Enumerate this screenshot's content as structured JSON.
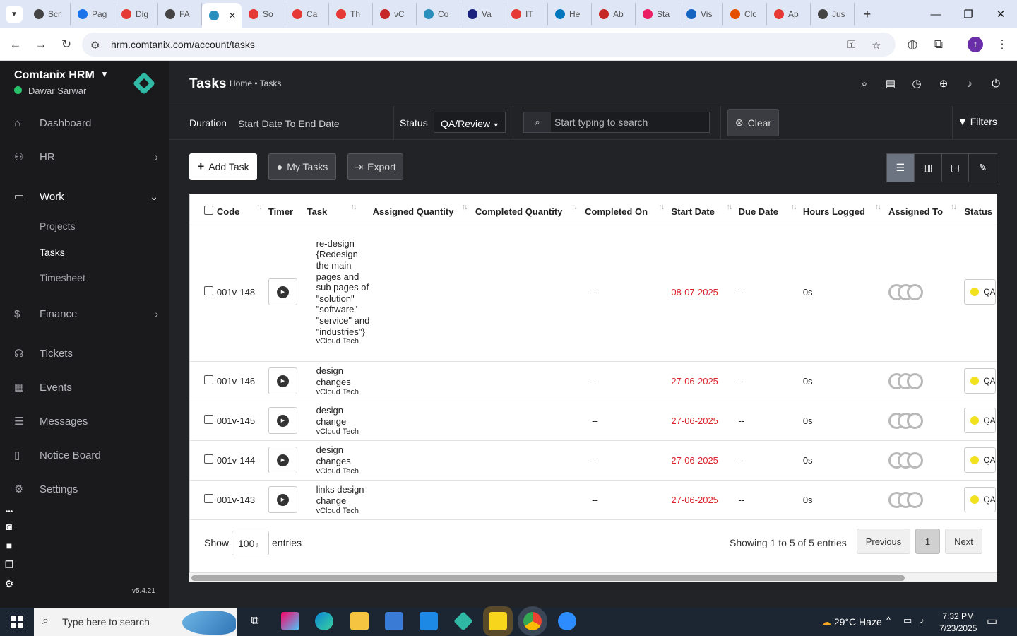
{
  "browser": {
    "tabs": [
      {
        "label": "Scr",
        "color": "#444"
      },
      {
        "label": "Pag",
        "color": "#1a73e8"
      },
      {
        "label": "Dig",
        "color": "#e53935"
      },
      {
        "label": "FA",
        "color": "#444"
      },
      {
        "label": "",
        "color": "#2a8fbd",
        "active": true
      },
      {
        "label": "So",
        "color": "#e53935"
      },
      {
        "label": "Ca",
        "color": "#e53935"
      },
      {
        "label": "Th",
        "color": "#e53935"
      },
      {
        "label": "vC",
        "color": "#c62828"
      },
      {
        "label": "Co",
        "color": "#2a8fbd"
      },
      {
        "label": "Va",
        "color": "#1a237e"
      },
      {
        "label": "IT",
        "color": "#e53935"
      },
      {
        "label": "He",
        "color": "#0277bd"
      },
      {
        "label": "Ab",
        "color": "#c62828"
      },
      {
        "label": "Sta",
        "color": "#e91e63"
      },
      {
        "label": "Vis",
        "color": "#1565c0"
      },
      {
        "label": "Clc",
        "color": "#e65100"
      },
      {
        "label": "Ap",
        "color": "#e53935"
      },
      {
        "label": "Jus",
        "color": "#444"
      }
    ],
    "url": "hrm.comtanix.com/account/tasks",
    "profile_initial": "t"
  },
  "app": {
    "brand": "Comtanix HRM",
    "user": "Dawar Sarwar",
    "version": "v5.4.21",
    "menu": {
      "dashboard": "Dashboard",
      "hr": "HR",
      "work": "Work",
      "projects": "Projects",
      "tasks": "Tasks",
      "timesheet": "Timesheet",
      "finance": "Finance",
      "tickets": "Tickets",
      "events": "Events",
      "messages": "Messages",
      "notice_board": "Notice Board",
      "settings": "Settings"
    }
  },
  "page": {
    "title": "Tasks",
    "breadcrumb": "Home • Tasks"
  },
  "filters": {
    "duration_label": "Duration",
    "duration_value": "Start Date To End Date",
    "status_label": "Status",
    "status_value": "QA/Review",
    "search_placeholder": "Start typing to search",
    "clear": "Clear",
    "filters": "Filters"
  },
  "toolbar": {
    "add_task": "Add Task",
    "my_tasks": "My Tasks",
    "export": "Export"
  },
  "table": {
    "headers": [
      "Code",
      "Timer",
      "Task",
      "Assigned Quantity",
      "Completed Quantity",
      "Completed On",
      "Start Date",
      "Due Date",
      "Hours Logged",
      "Assigned To",
      "Status"
    ],
    "rows": [
      {
        "code": "001v-148",
        "task": "re-design {Redesign the main pages and sub pages of \"solution\" \"software\" \"service\" and \"industries\"}",
        "client": "vCloud Tech",
        "completed_on": "--",
        "start_date": "08-07-2025",
        "due_date": "--",
        "hours": "0s",
        "status": "QA"
      },
      {
        "code": "001v-146",
        "task": "design changes",
        "client": "vCloud Tech",
        "completed_on": "--",
        "start_date": "27-06-2025",
        "due_date": "--",
        "hours": "0s",
        "status": "QA"
      },
      {
        "code": "001v-145",
        "task": "design change",
        "client": "vCloud Tech",
        "completed_on": "--",
        "start_date": "27-06-2025",
        "due_date": "--",
        "hours": "0s",
        "status": "QA"
      },
      {
        "code": "001v-144",
        "task": "design changes",
        "client": "vCloud Tech",
        "completed_on": "--",
        "start_date": "27-06-2025",
        "due_date": "--",
        "hours": "0s",
        "status": "QA"
      },
      {
        "code": "001v-143",
        "task": "links design change",
        "client": "vCloud Tech",
        "completed_on": "--",
        "start_date": "27-06-2025",
        "due_date": "--",
        "hours": "0s",
        "status": "QA"
      }
    ],
    "show": "Show",
    "entries_value": "100",
    "entries": "entries",
    "showing": "Showing 1 to 5 of 5 entries",
    "previous": "Previous",
    "page": "1",
    "next": "Next"
  },
  "taskbar": {
    "search_placeholder": "Type here to search",
    "weather": "29°C  Haze",
    "time": "7:32 PM",
    "date": "7/23/2025"
  },
  "colors": {
    "sidebar": "#1a1a1d",
    "main": "#222327",
    "accent": "#2fb9a5",
    "danger": "#d9232d",
    "online": "#29c469"
  }
}
